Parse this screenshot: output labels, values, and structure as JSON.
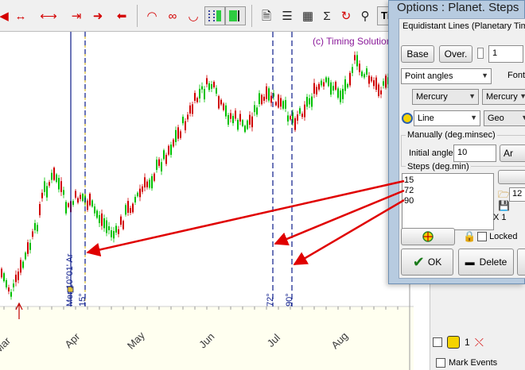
{
  "toolbar": {
    "time_label": "Tim"
  },
  "chart": {
    "copyright": "(c) Timing Solution",
    "vlines": [
      {
        "label": "Mer 10°01' Ar"
      },
      {
        "label": "15°"
      },
      {
        "label": "72°"
      },
      {
        "label": "90°"
      }
    ],
    "months": [
      "Mar",
      "Apr",
      "May",
      "Jun",
      "Jul",
      "Aug"
    ],
    "colors": {
      "up": "#00c000",
      "down": "#d00000",
      "annot_line": "#0a1a8a",
      "arrow": "#e00000"
    }
  },
  "dialog": {
    "title": "Options : Planet. Steps",
    "subtitle": "Equidistant Lines (Planetary Time",
    "base_button": "Base",
    "over_button": "Over.",
    "stepper_value": "1",
    "angle_mode": "Point angles",
    "font_label": "Font",
    "planet1": "Mercury",
    "planet2": "Mercury",
    "line_type": "Line",
    "coord_type": "Geo",
    "manual_label": "Manually (deg.minsec)",
    "initial_angle_label": "Initial angle",
    "initial_angle_value": "10",
    "zodiac_value": "Ar",
    "steps_label": "Steps (deg.min)",
    "steps": [
      "15",
      "72",
      "90"
    ],
    "side_value": "12",
    "multiplier_value": "X 1",
    "locked_label": "Locked",
    "ok_button": "OK",
    "delete_button": "Delete"
  },
  "side_panel": {
    "counter": "1",
    "mark_events_label": "Mark Events"
  }
}
